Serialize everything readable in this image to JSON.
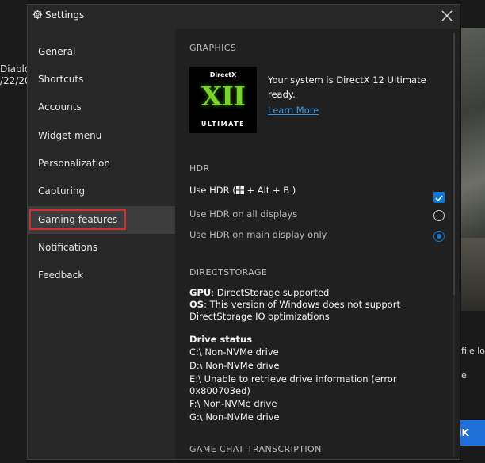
{
  "background_app": {
    "left_title": "Diablo",
    "left_date": "/22/20",
    "right_text_1": "file lo",
    "right_text_2": "e",
    "ok_label": "JK"
  },
  "dialog": {
    "title": "Settings",
    "close_icon": "close-icon",
    "title_icon": "gear-icon"
  },
  "nav": {
    "items": [
      {
        "label": "General"
      },
      {
        "label": "Shortcuts"
      },
      {
        "label": "Accounts"
      },
      {
        "label": "Widget menu"
      },
      {
        "label": "Personalization"
      },
      {
        "label": "Capturing"
      },
      {
        "label": "Gaming features",
        "selected": true
      },
      {
        "label": "Notifications"
      },
      {
        "label": "Feedback"
      }
    ]
  },
  "graphics": {
    "heading": "GRAPHICS",
    "logo_top": "DirectX",
    "logo_mid": "XII",
    "logo_bottom": "ULTIMATE",
    "status_line1": "Your system is DirectX 12 Ultimate",
    "status_line2": "ready.",
    "learn_more": "Learn More"
  },
  "hdr": {
    "heading": "HDR",
    "use_hdr_prefix": "Use HDR (",
    "use_hdr_suffix": " + Alt + B )",
    "use_hdr_checked": true,
    "all_displays": "Use HDR on all displays",
    "all_displays_selected": false,
    "main_display": "Use HDR on main display only",
    "main_display_selected": true
  },
  "directstorage": {
    "heading": "DIRECTSTORAGE",
    "gpu_label": "GPU",
    "gpu_value": ": DirectStorage supported",
    "os_label": "OS",
    "os_value": ": This version of Windows does not support",
    "os_value_2": "DirectStorage IO optimizations",
    "drive_status_heading": "Drive status",
    "drives": [
      "C:\\ Non-NVMe drive",
      "D:\\ Non-NVMe drive",
      "E:\\ Unable to retrieve drive information (error",
      "0x800703ed)",
      "F:\\ Non-NVMe drive",
      "G:\\ Non-NVMe drive"
    ]
  },
  "game_chat": {
    "heading": "GAME CHAT TRANSCRIPTION"
  },
  "colors": {
    "accent": "#0a78d4",
    "link": "#3a96dd",
    "selection_outline": "#d32f2f",
    "dx_green": "#7ad22c"
  }
}
